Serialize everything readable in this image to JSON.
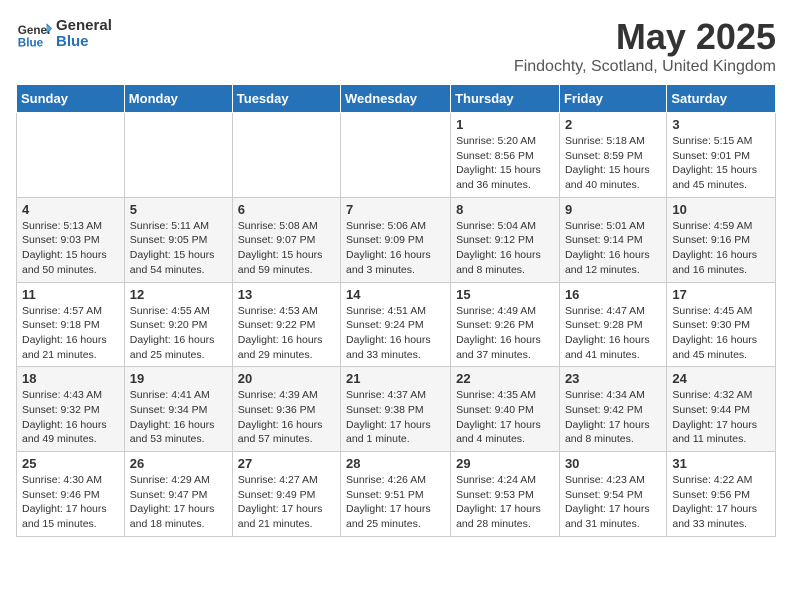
{
  "header": {
    "logo_general": "General",
    "logo_blue": "Blue",
    "title": "May 2025",
    "subtitle": "Findochty, Scotland, United Kingdom"
  },
  "weekdays": [
    "Sunday",
    "Monday",
    "Tuesday",
    "Wednesday",
    "Thursday",
    "Friday",
    "Saturday"
  ],
  "weeks": [
    [
      {
        "day": "",
        "info": ""
      },
      {
        "day": "",
        "info": ""
      },
      {
        "day": "",
        "info": ""
      },
      {
        "day": "",
        "info": ""
      },
      {
        "day": "1",
        "info": "Sunrise: 5:20 AM\nSunset: 8:56 PM\nDaylight: 15 hours and 36 minutes."
      },
      {
        "day": "2",
        "info": "Sunrise: 5:18 AM\nSunset: 8:59 PM\nDaylight: 15 hours and 40 minutes."
      },
      {
        "day": "3",
        "info": "Sunrise: 5:15 AM\nSunset: 9:01 PM\nDaylight: 15 hours and 45 minutes."
      }
    ],
    [
      {
        "day": "4",
        "info": "Sunrise: 5:13 AM\nSunset: 9:03 PM\nDaylight: 15 hours and 50 minutes."
      },
      {
        "day": "5",
        "info": "Sunrise: 5:11 AM\nSunset: 9:05 PM\nDaylight: 15 hours and 54 minutes."
      },
      {
        "day": "6",
        "info": "Sunrise: 5:08 AM\nSunset: 9:07 PM\nDaylight: 15 hours and 59 minutes."
      },
      {
        "day": "7",
        "info": "Sunrise: 5:06 AM\nSunset: 9:09 PM\nDaylight: 16 hours and 3 minutes."
      },
      {
        "day": "8",
        "info": "Sunrise: 5:04 AM\nSunset: 9:12 PM\nDaylight: 16 hours and 8 minutes."
      },
      {
        "day": "9",
        "info": "Sunrise: 5:01 AM\nSunset: 9:14 PM\nDaylight: 16 hours and 12 minutes."
      },
      {
        "day": "10",
        "info": "Sunrise: 4:59 AM\nSunset: 9:16 PM\nDaylight: 16 hours and 16 minutes."
      }
    ],
    [
      {
        "day": "11",
        "info": "Sunrise: 4:57 AM\nSunset: 9:18 PM\nDaylight: 16 hours and 21 minutes."
      },
      {
        "day": "12",
        "info": "Sunrise: 4:55 AM\nSunset: 9:20 PM\nDaylight: 16 hours and 25 minutes."
      },
      {
        "day": "13",
        "info": "Sunrise: 4:53 AM\nSunset: 9:22 PM\nDaylight: 16 hours and 29 minutes."
      },
      {
        "day": "14",
        "info": "Sunrise: 4:51 AM\nSunset: 9:24 PM\nDaylight: 16 hours and 33 minutes."
      },
      {
        "day": "15",
        "info": "Sunrise: 4:49 AM\nSunset: 9:26 PM\nDaylight: 16 hours and 37 minutes."
      },
      {
        "day": "16",
        "info": "Sunrise: 4:47 AM\nSunset: 9:28 PM\nDaylight: 16 hours and 41 minutes."
      },
      {
        "day": "17",
        "info": "Sunrise: 4:45 AM\nSunset: 9:30 PM\nDaylight: 16 hours and 45 minutes."
      }
    ],
    [
      {
        "day": "18",
        "info": "Sunrise: 4:43 AM\nSunset: 9:32 PM\nDaylight: 16 hours and 49 minutes."
      },
      {
        "day": "19",
        "info": "Sunrise: 4:41 AM\nSunset: 9:34 PM\nDaylight: 16 hours and 53 minutes."
      },
      {
        "day": "20",
        "info": "Sunrise: 4:39 AM\nSunset: 9:36 PM\nDaylight: 16 hours and 57 minutes."
      },
      {
        "day": "21",
        "info": "Sunrise: 4:37 AM\nSunset: 9:38 PM\nDaylight: 17 hours and 1 minute."
      },
      {
        "day": "22",
        "info": "Sunrise: 4:35 AM\nSunset: 9:40 PM\nDaylight: 17 hours and 4 minutes."
      },
      {
        "day": "23",
        "info": "Sunrise: 4:34 AM\nSunset: 9:42 PM\nDaylight: 17 hours and 8 minutes."
      },
      {
        "day": "24",
        "info": "Sunrise: 4:32 AM\nSunset: 9:44 PM\nDaylight: 17 hours and 11 minutes."
      }
    ],
    [
      {
        "day": "25",
        "info": "Sunrise: 4:30 AM\nSunset: 9:46 PM\nDaylight: 17 hours and 15 minutes."
      },
      {
        "day": "26",
        "info": "Sunrise: 4:29 AM\nSunset: 9:47 PM\nDaylight: 17 hours and 18 minutes."
      },
      {
        "day": "27",
        "info": "Sunrise: 4:27 AM\nSunset: 9:49 PM\nDaylight: 17 hours and 21 minutes."
      },
      {
        "day": "28",
        "info": "Sunrise: 4:26 AM\nSunset: 9:51 PM\nDaylight: 17 hours and 25 minutes."
      },
      {
        "day": "29",
        "info": "Sunrise: 4:24 AM\nSunset: 9:53 PM\nDaylight: 17 hours and 28 minutes."
      },
      {
        "day": "30",
        "info": "Sunrise: 4:23 AM\nSunset: 9:54 PM\nDaylight: 17 hours and 31 minutes."
      },
      {
        "day": "31",
        "info": "Sunrise: 4:22 AM\nSunset: 9:56 PM\nDaylight: 17 hours and 33 minutes."
      }
    ]
  ]
}
